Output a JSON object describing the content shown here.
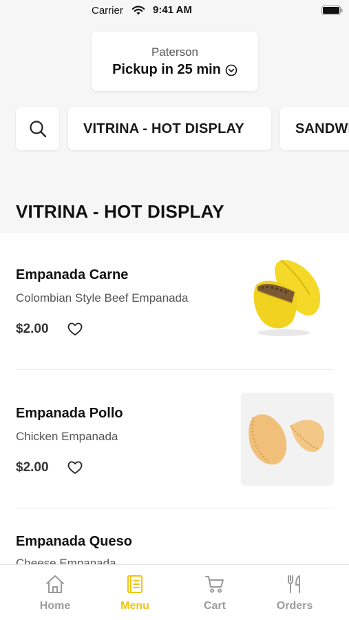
{
  "status_bar": {
    "carrier": "Carrier",
    "time": "9:41 AM"
  },
  "pickup": {
    "location": "Paterson",
    "time_text": "Pickup in 25 min"
  },
  "categories": [
    "VITRINA - HOT DISPLAY",
    "SANDWICHES"
  ],
  "section": {
    "title": "VITRINA - HOT DISPLAY"
  },
  "items": [
    {
      "name": "Empanada Carne",
      "description": "Colombian Style Beef Empanada",
      "price": "$2.00"
    },
    {
      "name": "Empanada Pollo",
      "description": "Chicken Empanada",
      "price": "$2.00"
    },
    {
      "name": "Empanada Queso",
      "description": "Cheese Empanada",
      "price": ""
    }
  ],
  "tabs": [
    {
      "label": "Home",
      "icon": "home-icon"
    },
    {
      "label": "Menu",
      "icon": "menu-icon"
    },
    {
      "label": "Cart",
      "icon": "cart-icon"
    },
    {
      "label": "Orders",
      "icon": "orders-icon"
    }
  ],
  "colors": {
    "accent": "#f2c40f",
    "background": "#f6f6f6",
    "inactive": "#9a9a9a"
  }
}
